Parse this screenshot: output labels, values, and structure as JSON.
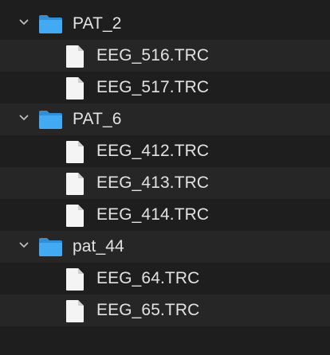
{
  "tree": [
    {
      "name": "PAT_2",
      "icon": "folder-icon",
      "expanded": true,
      "children": [
        {
          "name": "EEG_516.TRC",
          "icon": "file-icon"
        },
        {
          "name": "EEG_517.TRC",
          "icon": "file-icon"
        }
      ]
    },
    {
      "name": "PAT_6",
      "icon": "folder-icon",
      "expanded": true,
      "children": [
        {
          "name": "EEG_412.TRC",
          "icon": "file-icon"
        },
        {
          "name": "EEG_413.TRC",
          "icon": "file-icon"
        },
        {
          "name": "EEG_414.TRC",
          "icon": "file-icon"
        }
      ]
    },
    {
      "name": "pat_44",
      "icon": "folder-icon",
      "expanded": true,
      "children": [
        {
          "name": "EEG_64.TRC",
          "icon": "file-icon"
        },
        {
          "name": "EEG_65.TRC",
          "icon": "file-icon"
        }
      ]
    }
  ],
  "colors": {
    "background": "#1e1e1e",
    "alt_row": "#262626",
    "text": "#e2e2e2",
    "folder": "#3fa9f5",
    "file": "#f4f4f4"
  }
}
